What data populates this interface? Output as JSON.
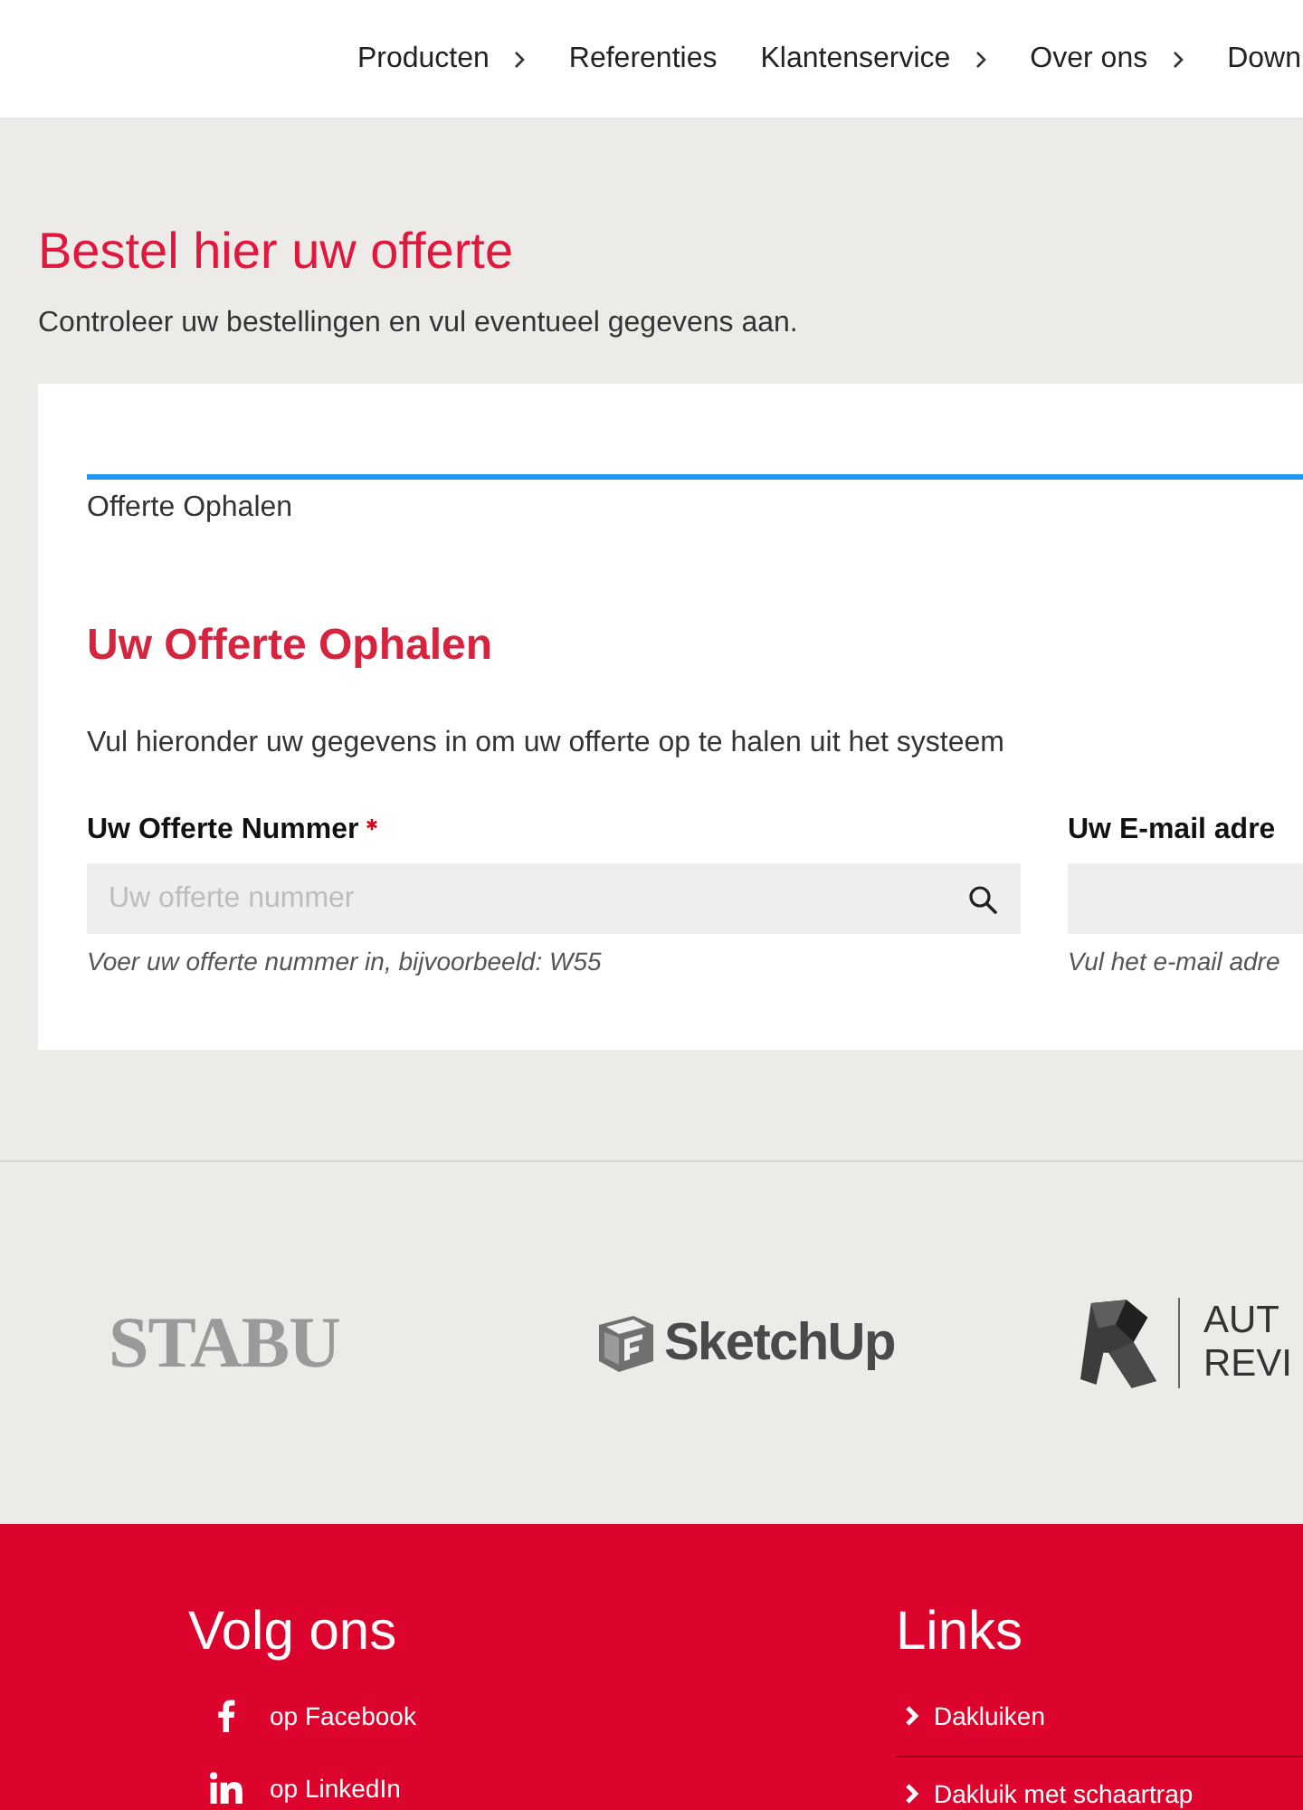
{
  "nav": {
    "items": [
      {
        "label": "Producten",
        "has_submenu": true
      },
      {
        "label": "Referenties",
        "has_submenu": false
      },
      {
        "label": "Klantenservice",
        "has_submenu": true
      },
      {
        "label": "Over ons",
        "has_submenu": true
      },
      {
        "label": "Down",
        "has_submenu": false
      }
    ]
  },
  "page": {
    "title": "Bestel hier uw offerte",
    "subtitle": "Controleer uw bestellingen en vul eventueel gegevens aan."
  },
  "card": {
    "steps": [
      {
        "label": "Offerte Ophalen",
        "selected": true
      }
    ],
    "heading": "Uw Offerte Ophalen",
    "intro": "Vul hieronder uw gegevens in om uw offerte op te halen uit het systeem",
    "fields": [
      {
        "label": "Uw Offerte Nummer",
        "required": true,
        "placeholder": "Uw offerte nummer",
        "search": true,
        "help": "Voer uw offerte nummer in, bijvoorbeeld: W55"
      },
      {
        "label": "Uw E-mail adre",
        "required": false,
        "search": false,
        "help": "Vul het e-mail adre"
      }
    ]
  },
  "logos": [
    {
      "kind": "stabu",
      "text": "STABU"
    },
    {
      "kind": "sketchup",
      "text": "SketchUp"
    },
    {
      "kind": "revit",
      "lines": [
        "AUT",
        "REVI"
      ]
    }
  ],
  "footer": {
    "social": {
      "title": "Volg ons",
      "items": [
        {
          "kind": "facebook",
          "label": "op Facebook"
        },
        {
          "kind": "linkedin",
          "label": "op LinkedIn"
        }
      ]
    },
    "links": {
      "title": "Links",
      "items": [
        "Dakluiken",
        "Dakluik met schaartrap"
      ]
    }
  }
}
